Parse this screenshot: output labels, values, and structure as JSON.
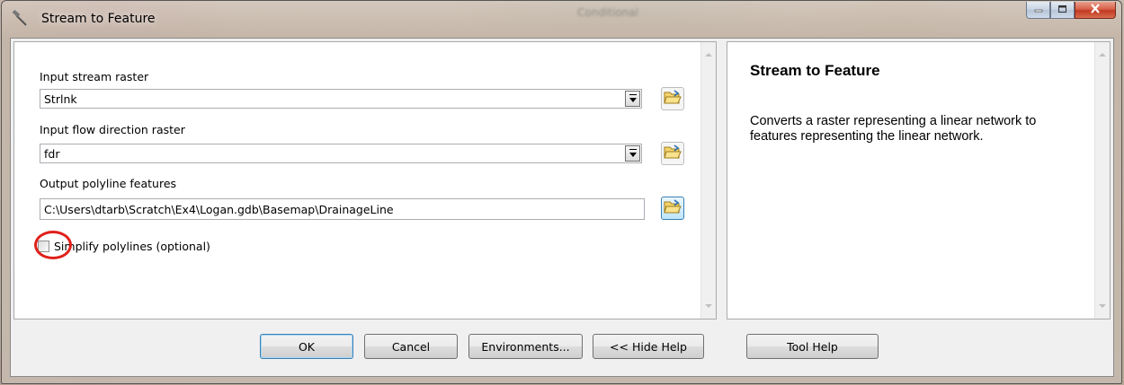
{
  "window": {
    "title": "Stream to Feature",
    "background_ghost_text": "Conditional",
    "controls": {
      "minimize": "minimize-icon",
      "maximize": "maximize-icon",
      "close": "close-icon"
    }
  },
  "params": {
    "input_stream_raster": {
      "label": "Input stream raster",
      "value": "Strlnk"
    },
    "input_flow_direction": {
      "label": "Input flow direction raster",
      "value": "fdr"
    },
    "output_polyline": {
      "label": "Output polyline features",
      "value": "C:\\Users\\dtarb\\Scratch\\Ex4\\Logan.gdb\\Basemap\\DrainageLine"
    },
    "simplify": {
      "label": "Simplify polylines (optional)",
      "checked": false
    }
  },
  "help": {
    "title": "Stream to Feature",
    "body": "Converts a raster representing a linear network to features representing the linear network."
  },
  "buttons": {
    "ok": "OK",
    "cancel": "Cancel",
    "environments": "Environments...",
    "hide_help": "<< Hide Help",
    "tool_help": "Tool Help"
  },
  "colors": {
    "annotation_circle": "#e0201a",
    "close_button": "#c23b22"
  }
}
